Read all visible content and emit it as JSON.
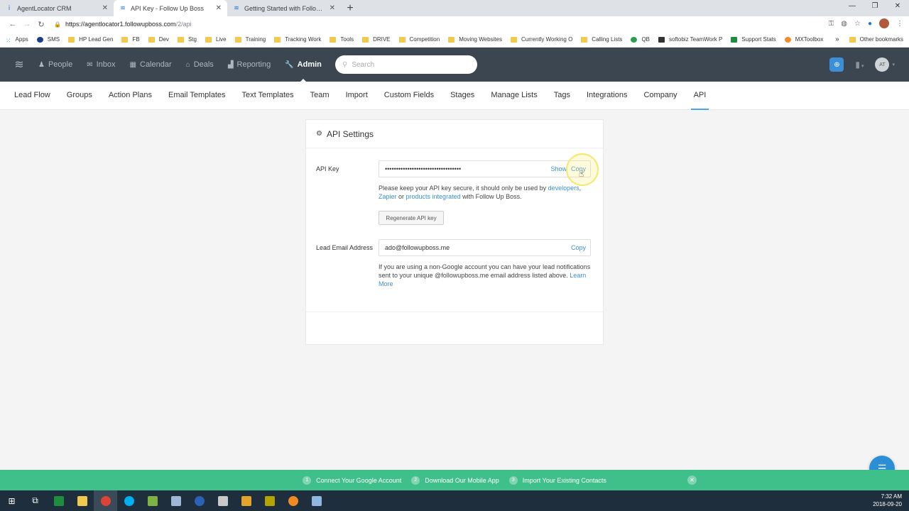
{
  "browser": {
    "tabs": [
      {
        "title": "AgentLocator CRM",
        "active": false
      },
      {
        "title": "API Key - Follow Up Boss",
        "active": true
      },
      {
        "title": "Getting Started with Follow Up B",
        "active": false
      }
    ],
    "url_host": "https://agentlocator1.followupboss.com",
    "url_path": "/2/api",
    "bookmarks": [
      {
        "label": "Apps",
        "icon": "apps-grid-icon"
      },
      {
        "label": "SMS",
        "icon": "sms-icon"
      },
      {
        "label": "HP Lead Gen",
        "icon": "folder-icon"
      },
      {
        "label": "FB",
        "icon": "folder-icon"
      },
      {
        "label": "Dev",
        "icon": "folder-icon"
      },
      {
        "label": "Stg",
        "icon": "folder-icon"
      },
      {
        "label": "Live",
        "icon": "folder-icon"
      },
      {
        "label": "Training",
        "icon": "folder-icon"
      },
      {
        "label": "Tracking Work",
        "icon": "folder-icon"
      },
      {
        "label": "Tools",
        "icon": "folder-icon"
      },
      {
        "label": "DRIVE",
        "icon": "folder-icon"
      },
      {
        "label": "Competition",
        "icon": "folder-icon"
      },
      {
        "label": "Moving Websites",
        "icon": "folder-icon"
      },
      {
        "label": "Currently Working O",
        "icon": "folder-icon"
      },
      {
        "label": "Calling Lists",
        "icon": "folder-icon"
      },
      {
        "label": "QB",
        "icon": "quickbooks-icon"
      },
      {
        "label": "softobiz TeamWork P",
        "icon": "teamwork-icon"
      },
      {
        "label": "Support Stats",
        "icon": "sheets-icon"
      },
      {
        "label": "MXToolbox",
        "icon": "mxtoolbox-icon"
      }
    ],
    "other_bookmarks": "Other bookmarks"
  },
  "app": {
    "nav": [
      {
        "label": "People",
        "icon": "person-icon"
      },
      {
        "label": "Inbox",
        "icon": "inbox-icon"
      },
      {
        "label": "Calendar",
        "icon": "calendar-icon"
      },
      {
        "label": "Deals",
        "icon": "home-icon"
      },
      {
        "label": "Reporting",
        "icon": "bar-chart-icon"
      },
      {
        "label": "Admin",
        "icon": "wrench-icon",
        "active": true
      }
    ],
    "search_placeholder": "Search",
    "user_initials": "AT",
    "accent": "#4ea6dc",
    "header_bg": "#3b4650"
  },
  "subnav": [
    "Lead Flow",
    "Groups",
    "Action Plans",
    "Email Templates",
    "Text Templates",
    "Team",
    "Import",
    "Custom Fields",
    "Stages",
    "Manage Lists",
    "Tags",
    "Integrations",
    "Company",
    "API"
  ],
  "subnav_active": "API",
  "card": {
    "title": "API Settings",
    "api_key_label": "API Key",
    "api_key_value": "••••••••••••••••••••••••••••••••••",
    "show_label": "Show",
    "copy_label": "Copy",
    "api_help_1": "Please keep your API key secure, it should only be used by ",
    "api_help_link1": "developers",
    "api_help_2": ",",
    "api_help_link2": "Zapier",
    "api_help_3": " or ",
    "api_help_link3": "products integrated",
    "api_help_4": " with Follow Up Boss.",
    "regen_label": "Regenerate API key",
    "lead_email_label": "Lead Email Address",
    "lead_email_value": "ado@followupboss.me",
    "lead_copy_label": "Copy",
    "lead_help": "If you are using a non-Google account you can have your lead notifications sent to your unique @followupboss.me email address listed above. ",
    "learn_more": "Learn More"
  },
  "banner": {
    "steps": [
      {
        "num": "1",
        "label": "Connect Your Google Account"
      },
      {
        "num": "2",
        "label": "Download Our Mobile App"
      },
      {
        "num": "3",
        "label": "Import Your Existing Contacts"
      }
    ],
    "color": "#3fbf8a"
  },
  "taskbar": {
    "time": "7:32 AM",
    "date": "2018-09-20"
  }
}
